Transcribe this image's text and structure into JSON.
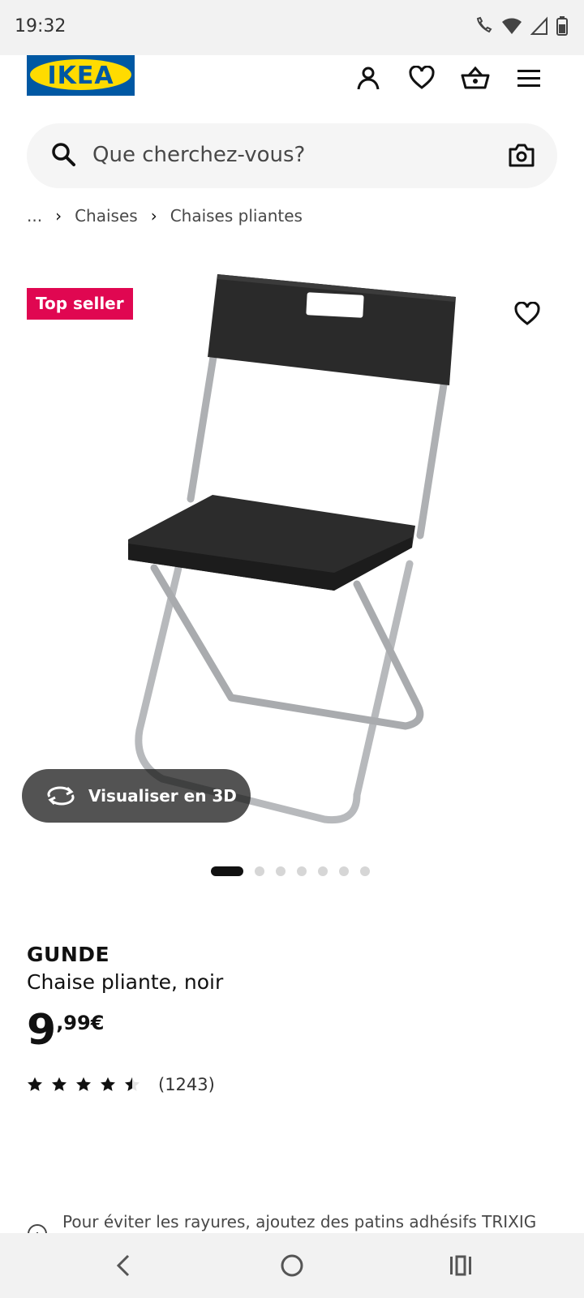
{
  "status_bar": {
    "time": "19:32"
  },
  "header": {
    "logo_text": "IKEA"
  },
  "search": {
    "placeholder": "Que cherchez-vous?"
  },
  "breadcrumb": {
    "items": [
      "...",
      "Chaises",
      "Chaises pliantes"
    ]
  },
  "product": {
    "badge": "Top seller",
    "view_3d_label": "Visualiser en 3D",
    "carousel": {
      "total": 7,
      "active_index": 0
    },
    "name": "GUNDE",
    "description": "Chaise pliante, noir",
    "price_integer": "9",
    "price_decimal": ",99€",
    "rating": {
      "value": 4.5,
      "max": 5,
      "count": "(1243)"
    },
    "info_text": "Pour éviter les rayures, ajoutez des patins adhésifs TRIXIG"
  },
  "colors": {
    "brand_blue": "#0058a3",
    "brand_yellow": "#ffdb00",
    "badge_red": "#e00751"
  }
}
